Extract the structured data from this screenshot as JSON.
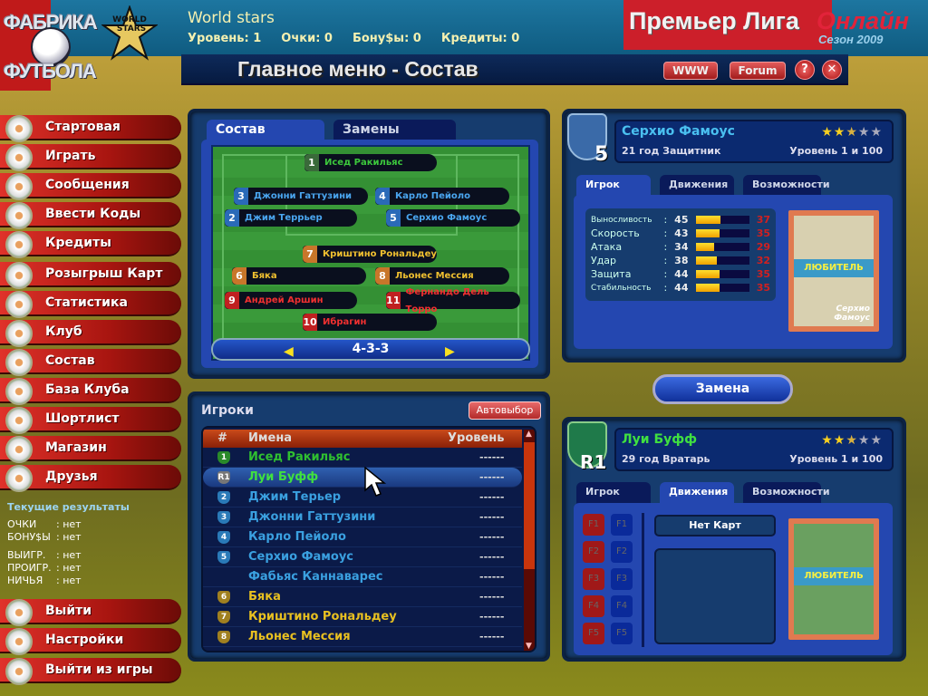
{
  "logo": {
    "line1": "ФАБРИКА",
    "line2": "ФУТБОЛА",
    "badge": "WORLD STARS"
  },
  "header": {
    "title": "World stars",
    "stats": [
      "Уровень: 1",
      "Очки: 0",
      "Бону$ы: 0",
      "Кредиты: 0"
    ],
    "brand": {
      "main": "Премьер Лига",
      "accent": "Онлайн",
      "season": "Сезон 2009"
    }
  },
  "titlebar": {
    "title": "Главное меню - Состав",
    "www": "WWW",
    "forum": "Forum",
    "help": "?",
    "close": "✕"
  },
  "sidebar": {
    "items": [
      "Стартовая",
      "Играть",
      "Сообщения",
      "Ввести Коды",
      "Кредиты",
      "Розыгрыш Карт",
      "Статистика",
      "Клуб",
      "Состав",
      "База Клуба",
      "Шортлист",
      "Магазин",
      "Друзья"
    ],
    "bottom": [
      "Выйти",
      "Настройки",
      "Выйти из игры"
    ]
  },
  "results": {
    "title": "Текущие результаты",
    "rows": [
      [
        "ОЧКИ",
        ": нет"
      ],
      [
        "БОНУ$Ы",
        ": нет"
      ],
      [
        "ВЫИГР.",
        ": нет"
      ],
      [
        "ПРОИГР.",
        ": нет"
      ],
      [
        "НИЧЬЯ",
        ": нет"
      ]
    ]
  },
  "lineup": {
    "tabs": [
      "Состав",
      "Замены"
    ],
    "active_tab": "Состав",
    "formation": "4-3-3",
    "players": [
      {
        "num": "1",
        "name": "Исед Ракильяс",
        "color": "#3cc83c",
        "badge": "#3a6a3a"
      },
      {
        "num": "3",
        "name": "Джонни Гаттузини",
        "color": "#4aa6f0",
        "badge": "#2a6ab8"
      },
      {
        "num": "4",
        "name": "Карло Пейоло",
        "color": "#4aa6f0",
        "badge": "#2a6ab8"
      },
      {
        "num": "2",
        "name": "Джим Террьер",
        "color": "#4aa6f0",
        "badge": "#2a6ab8"
      },
      {
        "num": "5",
        "name": "Серхио Фамоус",
        "color": "#4aa6f0",
        "badge": "#2a6ab8"
      },
      {
        "num": "7",
        "name": "Криштино Рональдеу",
        "color": "#f0c030",
        "badge": "#c8762a"
      },
      {
        "num": "6",
        "name": "Бяка",
        "color": "#f0c030",
        "badge": "#c8762a"
      },
      {
        "num": "8",
        "name": "Льонес Мессия",
        "color": "#f0c030",
        "badge": "#c8762a"
      },
      {
        "num": "9",
        "name": "Андрей Аршин",
        "color": "#f03030",
        "badge": "#c02020"
      },
      {
        "num": "11",
        "name": "Фернандо Дель Торро",
        "color": "#f03030",
        "badge": "#c02020"
      },
      {
        "num": "10",
        "name": "Ибрагин",
        "color": "#f03030",
        "badge": "#c02020"
      }
    ]
  },
  "players_list": {
    "title": "Игроки",
    "auto_button": "Автовыбор",
    "columns": [
      "#",
      "Имена",
      "Уровень"
    ],
    "rows": [
      {
        "num": "1",
        "name": "Исед Ракильяс",
        "level": "------",
        "color": "#30c030",
        "badge": "#2a8a2a"
      },
      {
        "num": "R1",
        "name": "Луи Буфф",
        "level": "------",
        "color": "#40e040",
        "badge": "#777",
        "selected": true
      },
      {
        "num": "2",
        "name": "Джим Терьер",
        "level": "------",
        "color": "#3aa0e0",
        "badge": "#2a7ab8"
      },
      {
        "num": "3",
        "name": "Джонни Гаттузини",
        "level": "------",
        "color": "#3aa0e0",
        "badge": "#2a7ab8"
      },
      {
        "num": "4",
        "name": "Карло Пейоло",
        "level": "------",
        "color": "#3aa0e0",
        "badge": "#2a7ab8"
      },
      {
        "num": "5",
        "name": "Серхио Фамоус",
        "level": "------",
        "color": "#3aa0e0",
        "badge": "#2a7ab8"
      },
      {
        "num": "",
        "name": "Фабьяс Каннаварес",
        "level": "------",
        "color": "#3aa0e0",
        "badge": ""
      },
      {
        "num": "6",
        "name": "Бяка",
        "level": "------",
        "color": "#e8c020",
        "badge": "#a08020"
      },
      {
        "num": "7",
        "name": "Криштино Рональдеу",
        "level": "------",
        "color": "#e8c020",
        "badge": "#a08020"
      },
      {
        "num": "8",
        "name": "Льонес Мессия",
        "level": "------",
        "color": "#e8c020",
        "badge": "#a08020"
      }
    ]
  },
  "player1": {
    "shirt": "5",
    "name": "Серхио Фамоус",
    "info": "21 год Защитник",
    "level": "Уровень 1 и 100",
    "rating_stars": 2.5,
    "tabs": [
      "Игрок",
      "Движения",
      "Возможности"
    ],
    "active_tab": "Игрок",
    "stats": [
      {
        "label": "Выносливость",
        "value": 45,
        "bonus": "37"
      },
      {
        "label": "Скорость",
        "value": 43,
        "bonus": "35"
      },
      {
        "label": "Атака",
        "value": 34,
        "bonus": "29"
      },
      {
        "label": "Удар",
        "value": 38,
        "bonus": "32"
      },
      {
        "label": "Защита",
        "value": 44,
        "bonus": "35"
      },
      {
        "label": "Стабильность",
        "value": 44,
        "bonus": "35"
      }
    ],
    "card": {
      "rank": "ЛЮБИТЕЛЬ",
      "name": "Серхио Фамоус"
    }
  },
  "swap_button": "Замена",
  "player2": {
    "shirt": "R1",
    "name": "Луи Буфф",
    "info": "29 год Вратарь",
    "level": "Уровень 1 и 100",
    "rating_stars": 2.5,
    "tabs": [
      "Игрок",
      "Движения",
      "Возможности"
    ],
    "active_tab": "Движения",
    "fkeys": [
      "F1",
      "F2",
      "F3",
      "F4",
      "F5"
    ],
    "no_cards": "Нет Карт",
    "card": {
      "rank": "ЛЮБИТЕЛЬ"
    }
  },
  "colors": {
    "sidebar": "#c01a10",
    "panel": "#163c6e",
    "accent_gold": "#c9a640"
  }
}
